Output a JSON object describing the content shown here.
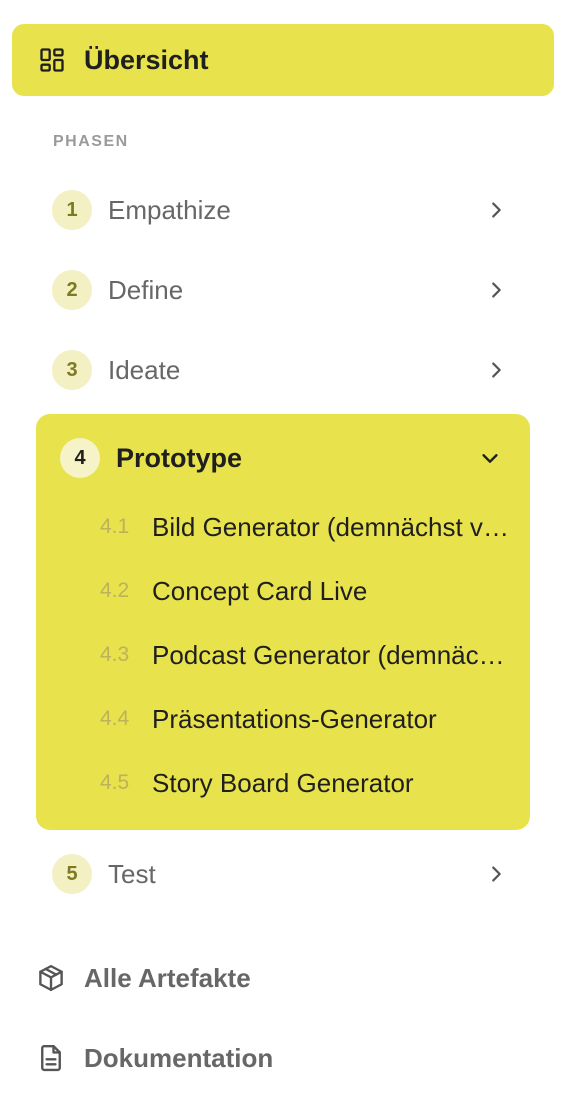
{
  "overview": {
    "label": "Übersicht",
    "icon": "layout-grid-icon"
  },
  "phases_header": "PHASEN",
  "phases": [
    {
      "number": "1",
      "label": "Empathize",
      "state": "collapsed"
    },
    {
      "number": "2",
      "label": "Define",
      "state": "collapsed"
    },
    {
      "number": "3",
      "label": "Ideate",
      "state": "collapsed"
    },
    {
      "number": "4",
      "label": "Prototype",
      "state": "expanded",
      "items": [
        {
          "number": "4.1",
          "label": "Bild Generator (demnächst verfügbar)"
        },
        {
          "number": "4.2",
          "label": "Concept Card Live"
        },
        {
          "number": "4.3",
          "label": "Podcast Generator (demnächst verfügbar)"
        },
        {
          "number": "4.4",
          "label": "Präsentations-Generator"
        },
        {
          "number": "4.5",
          "label": "Story Board Generator"
        }
      ]
    },
    {
      "number": "5",
      "label": "Test",
      "state": "collapsed"
    }
  ],
  "links": [
    {
      "label": "Alle Artefakte",
      "icon": "package-icon"
    },
    {
      "label": "Dokumentation",
      "icon": "document-icon"
    }
  ],
  "colors": {
    "accent": "#e8e24d",
    "badge": "#f3f0c4",
    "text": "#676767",
    "active_text": "#1f1f1f"
  }
}
